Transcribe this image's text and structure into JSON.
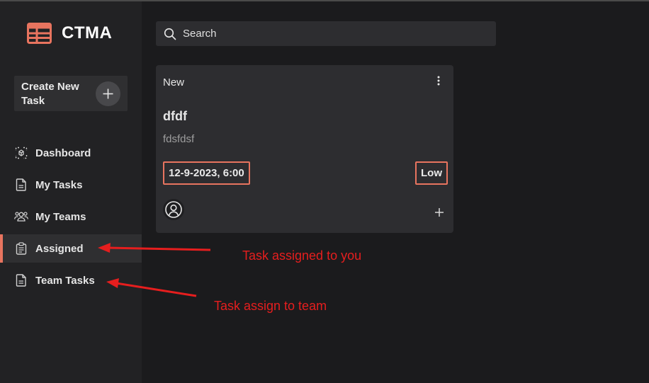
{
  "app": {
    "name": "CTMA",
    "accent_color": "#e8745f",
    "logo_icon": "table-icon"
  },
  "sidebar": {
    "create": {
      "label": "Create New Task",
      "icon": "plus-icon"
    },
    "items": [
      {
        "label": "Dashboard",
        "icon": "dashboard-icon",
        "active": false
      },
      {
        "label": "My Tasks",
        "icon": "document-icon",
        "active": false
      },
      {
        "label": "My Teams",
        "icon": "users-icon",
        "active": false
      },
      {
        "label": "Assigned",
        "icon": "clipboard-icon",
        "active": true
      },
      {
        "label": "Team Tasks",
        "icon": "document-icon",
        "active": false
      }
    ]
  },
  "search": {
    "placeholder": "Search",
    "icon": "search-icon"
  },
  "task_card": {
    "status": "New",
    "title": "dfdf",
    "description": "fdsfdsf",
    "due": "12-9-2023, 6:00",
    "priority": "Low",
    "menu_icon": "more-vertical-icon",
    "avatar_icon": "user-circle-icon",
    "add_icon": "plus-icon"
  },
  "annotations": {
    "color": "#e61e1e",
    "assigned_note": "Task assigned to you",
    "team_note": "Task assign to team"
  }
}
